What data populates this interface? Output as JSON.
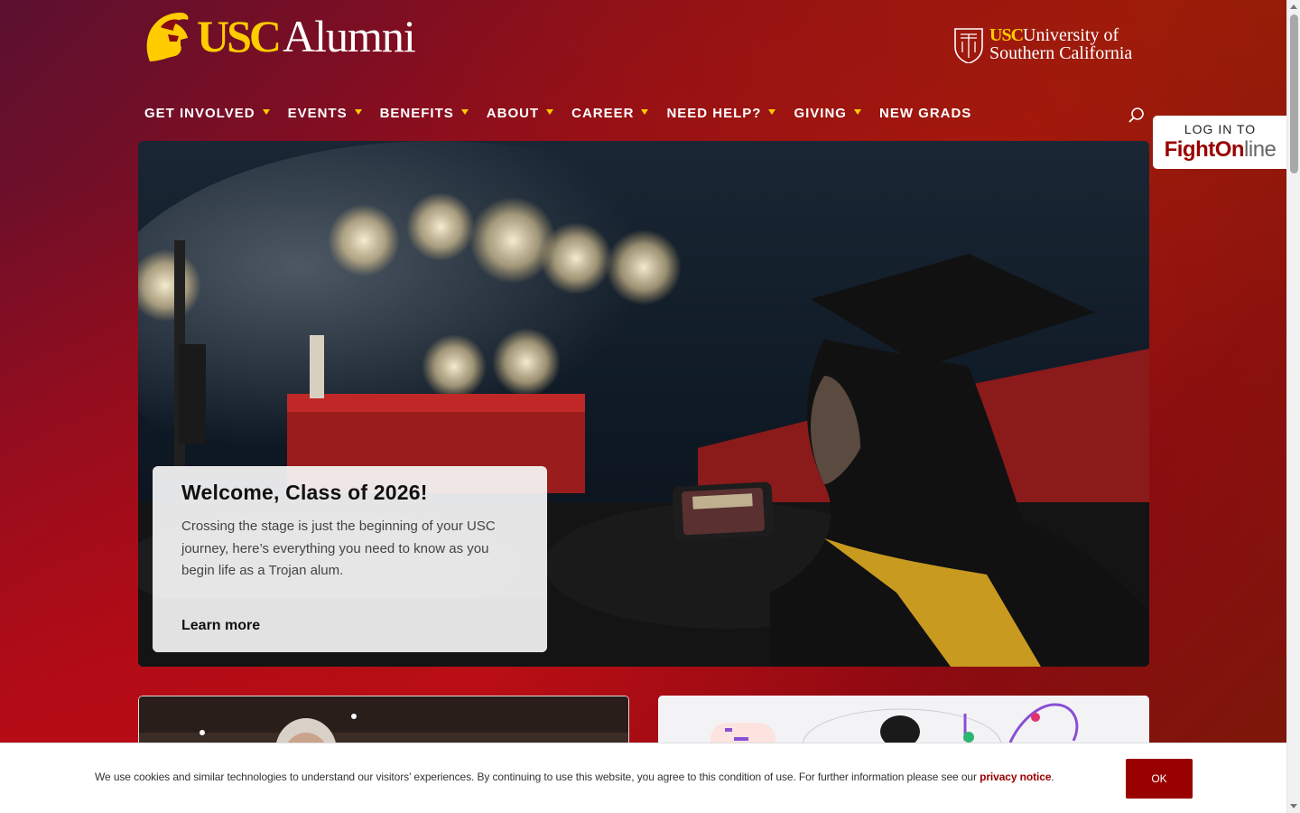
{
  "header": {
    "logo_usc": "USC",
    "logo_word": "Alumni",
    "univ_usc": "USC",
    "univ_line1": "University of",
    "univ_line2": "Southern California"
  },
  "nav": {
    "items": [
      {
        "label": "GET INVOLVED",
        "dropdown": true
      },
      {
        "label": "EVENTS",
        "dropdown": true
      },
      {
        "label": "BENEFITS",
        "dropdown": true
      },
      {
        "label": "ABOUT",
        "dropdown": true
      },
      {
        "label": "CAREER",
        "dropdown": true
      },
      {
        "label": "NEED HELP?",
        "dropdown": true
      },
      {
        "label": "GIVING",
        "dropdown": true
      },
      {
        "label": "NEW GRADS",
        "dropdown": false
      }
    ],
    "search_icon": "search-icon"
  },
  "login": {
    "top": "LOG IN TO",
    "brand_fight": "Fight",
    "brand_on": "On",
    "brand_line": "line"
  },
  "hero": {
    "title": "Welcome, Class of 2026!",
    "text": "Crossing the stage is just the beginning of your USC journey, here’s everything you need to know as you begin life as a Trojan alum.",
    "link": "Learn more"
  },
  "cookie": {
    "text": "We use cookies and similar technologies to understand our visitors’ experiences. By continuing to use this website, you agree to this condition of use. For further information please see our",
    "link": "privacy notice",
    "period": ".",
    "ok": "OK"
  },
  "colors": {
    "cardinal": "#990000",
    "gold": "#ffcc00"
  }
}
